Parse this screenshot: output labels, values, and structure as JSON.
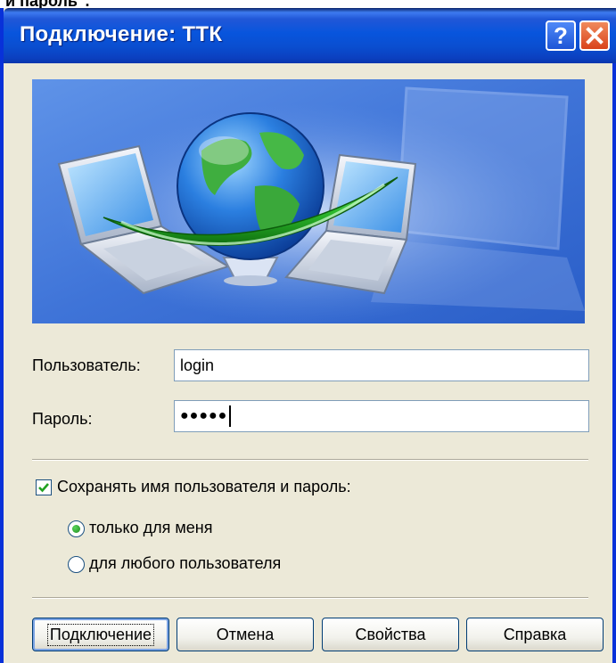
{
  "caption": "и пароль\".",
  "window": {
    "title": "Подключение: ТТК",
    "help_icon": "?",
    "close_icon": "×"
  },
  "form": {
    "user_label": "Пользователь:",
    "user_value": "login",
    "password_label": "Пароль:",
    "password_value": "●●●●●"
  },
  "save": {
    "label": "Сохранять имя пользователя и пароль:",
    "checked": true,
    "options": [
      "только для меня",
      "для любого пользователя"
    ],
    "selected_index": 0
  },
  "buttons": {
    "connect": "Подключение",
    "cancel": "Отмена",
    "properties": "Свойства",
    "help": "Справка"
  },
  "icons": [
    "help-icon",
    "close-icon",
    "network-globe-illustration",
    "check-icon"
  ],
  "colors": {
    "titlebar": "#0855dd",
    "dialog_bg": "#ece9d8",
    "banner_bg": "#3e74d6",
    "button_border": "#003c74"
  }
}
